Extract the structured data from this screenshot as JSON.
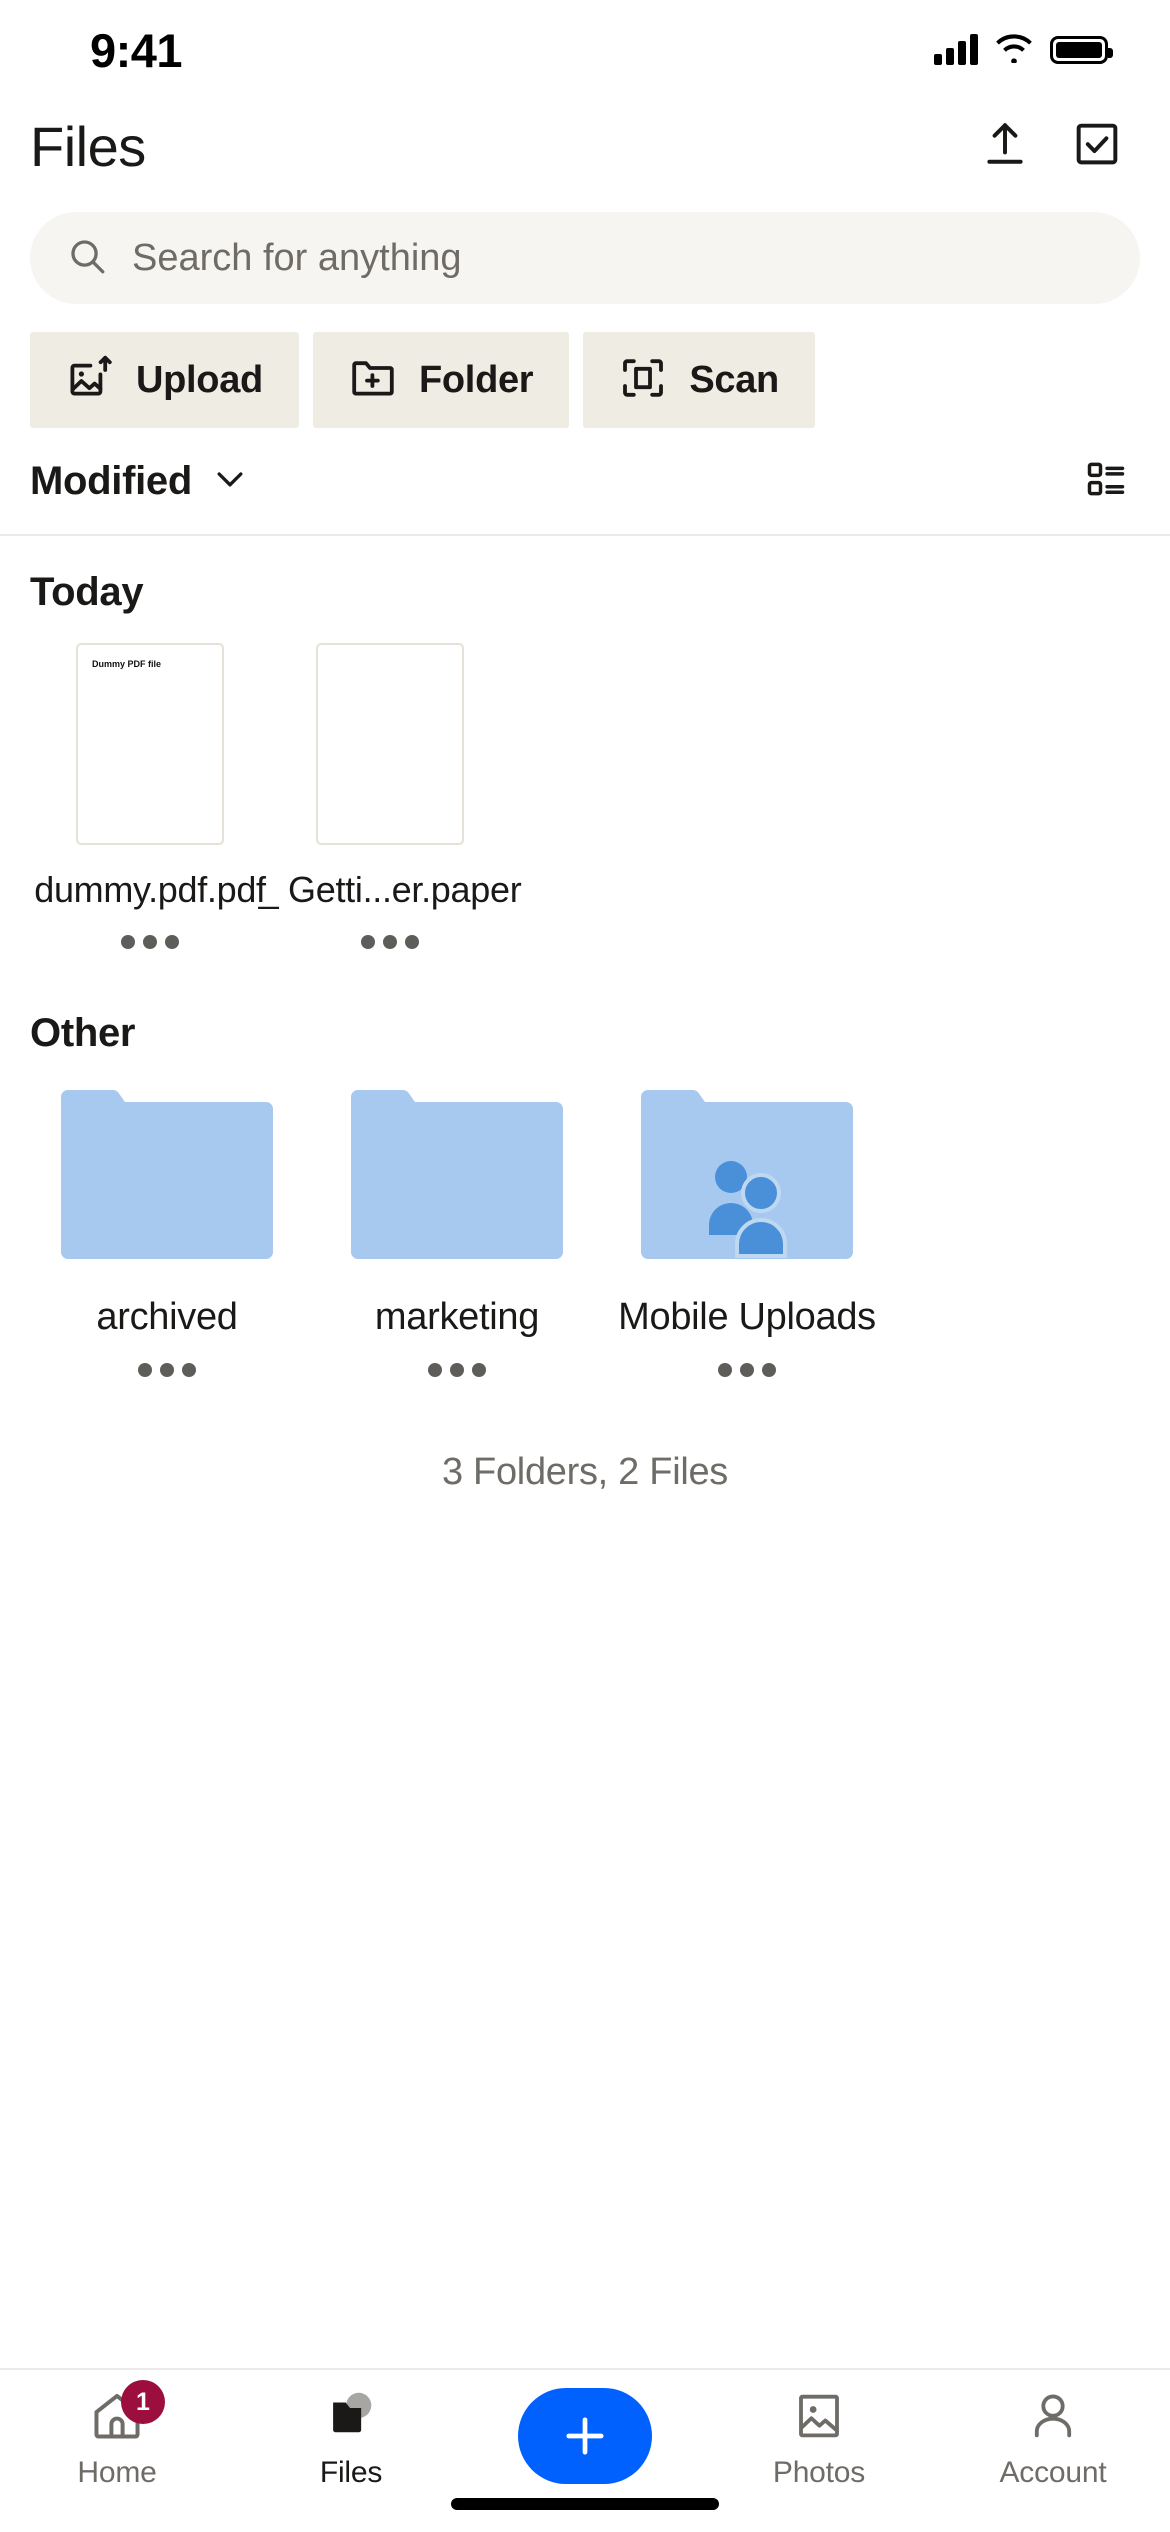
{
  "status_bar": {
    "time": "9:41",
    "cellular_icon": "signal-bars-icon",
    "wifi_icon": "wifi-icon",
    "battery_icon": "battery-full-icon"
  },
  "header": {
    "title": "Files",
    "upload_icon": "upload-arrow-icon",
    "select_icon": "checkbox-check-icon"
  },
  "search": {
    "placeholder": "Search for anything",
    "value": "",
    "icon": "search-icon"
  },
  "quick_actions": [
    {
      "label": "Upload",
      "icon": "image-upload-icon"
    },
    {
      "label": "Folder",
      "icon": "folder-plus-icon"
    },
    {
      "label": "Scan",
      "icon": "scan-frame-icon"
    }
  ],
  "sort_bar": {
    "sort_label": "Modified",
    "chevron_icon": "chevron-down-icon",
    "view_toggle_icon": "list-view-icon"
  },
  "sections": [
    {
      "title": "Today",
      "type": "files",
      "items": [
        {
          "name": "dummy.pdf.pdf",
          "thumb_text": "Dummy PDF file",
          "menu_icon": "overflow-menu-icon"
        },
        {
          "name": "_ Getti...er.paper",
          "thumb_text": "",
          "menu_icon": "overflow-menu-icon"
        }
      ]
    },
    {
      "title": "Other",
      "type": "folders",
      "items": [
        {
          "name": "archived",
          "shared": false,
          "menu_icon": "overflow-menu-icon"
        },
        {
          "name": "marketing",
          "shared": false,
          "menu_icon": "overflow-menu-icon"
        },
        {
          "name": "Mobile Uploads",
          "shared": true,
          "menu_icon": "overflow-menu-icon"
        }
      ]
    }
  ],
  "footer": {
    "count_text": "3 Folders, 2 Files"
  },
  "tab_bar": {
    "tabs": [
      {
        "label": "Home",
        "icon": "home-icon",
        "badge": "1",
        "active": false
      },
      {
        "label": "Files",
        "icon": "folder-icon",
        "badge": "",
        "active": true
      },
      {
        "label": "Photos",
        "icon": "photo-icon",
        "badge": "",
        "active": false
      },
      {
        "label": "Account",
        "icon": "person-icon",
        "badge": "",
        "active": false
      }
    ],
    "fab": {
      "label": "+",
      "icon": "plus-icon"
    }
  },
  "colors": {
    "accent_blue": "#0061fe",
    "folder_blue": "#a8c9ef",
    "folder_people_blue": "#4a90d9",
    "action_bg": "#efece4",
    "search_bg": "#f7f5f2",
    "badge_red": "#9b0e3e",
    "text_primary": "#1a1918",
    "text_secondary": "#6f6c68"
  }
}
